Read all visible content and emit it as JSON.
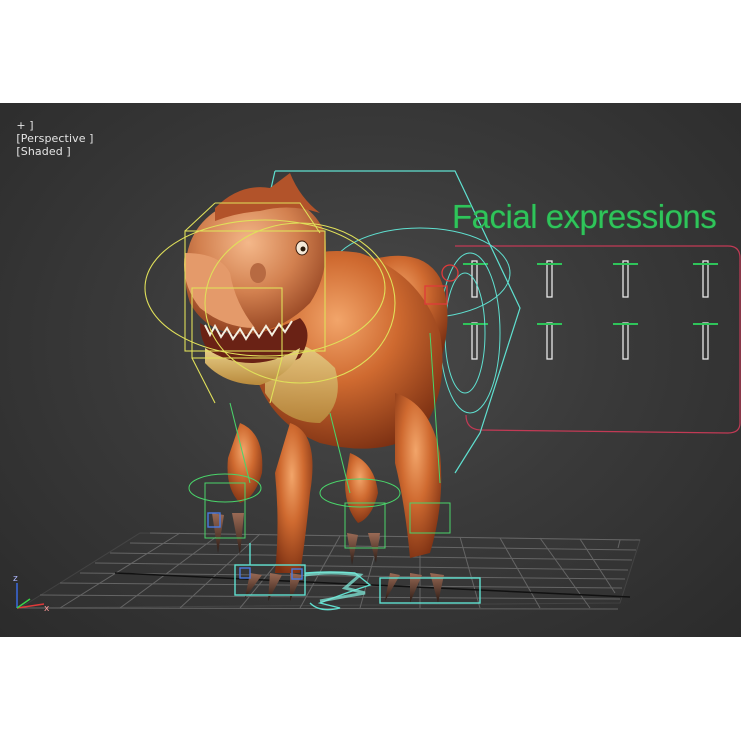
{
  "viewport": {
    "label_menu": "+ ]",
    "label_view": "[Perspective ]",
    "label_shading": "[Shaded ]"
  },
  "facial_panel": {
    "title": "Facial expressions"
  },
  "axis": {
    "z_label": "z",
    "x_label": "x"
  },
  "colors": {
    "viewport_bg": "#3a3a3a",
    "rig_cyan": "#5fe0d0",
    "rig_yellow": "#e0e05a",
    "rig_green": "#4ad46a",
    "panel_border": "#c23a55",
    "body_orange": "#c8622a",
    "grid": "#6a6a6a"
  }
}
